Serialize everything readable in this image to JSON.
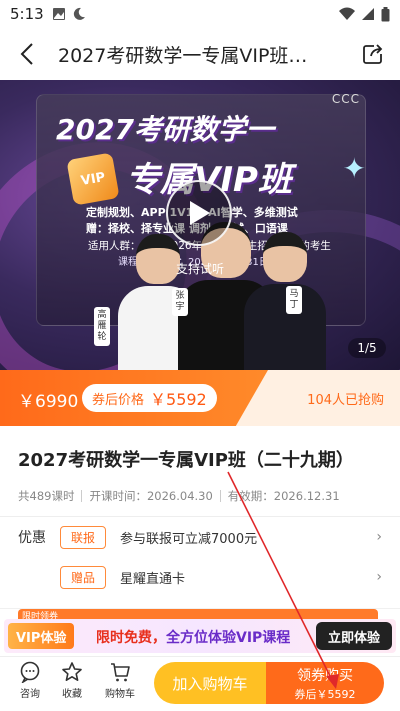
{
  "status_bar": {
    "time": "5:13",
    "left_icons": [
      "image-icon",
      "moon-icon"
    ],
    "right_icons": [
      "wifi-icon",
      "signal-icon",
      "battery-icon"
    ]
  },
  "nav": {
    "title": "2027考研数学一专属VIP班…",
    "back_icon": "back-chevron-icon",
    "share_icon": "share-icon"
  },
  "banner": {
    "brand_mark": "CCC",
    "headline_1": "2027考研数学一",
    "headline_2": "专属VIP班",
    "badge": "VIP",
    "features_1": "定制规划、APP 1V1    、AI智学、多维测试",
    "features_2": "赠：择校、择专业课    调剂、复试、口语课",
    "audience": "适用人群：参加 2026年12月研究生招生考试的考生",
    "validity": "课程有效期为：2026年12月31日",
    "trial": "支持试听",
    "teacher_names": [
      "高雁轮",
      "张宇",
      "马丁"
    ],
    "pager": "1/5"
  },
  "price": {
    "original": "￥6990",
    "coupon_label": "券后价格",
    "coupon_value": "￥5592",
    "bought": "104人已抢购"
  },
  "course": {
    "title": "2027考研数学一专属VIP班（二十九期）",
    "lessons": "共489课时",
    "open_time": "开课时间：2026.04.30",
    "valid_until": "有效期：2026.12.31"
  },
  "offers": {
    "label": "优惠",
    "items": [
      {
        "tag": "联报",
        "text": "参与联报可立减7000元"
      },
      {
        "tag": "赠品",
        "text": "星耀直通卡"
      }
    ]
  },
  "vip_promo": {
    "peek_text": "限时领券",
    "badge": "VIP体验",
    "text_red": "限时免费，",
    "text_purple": "全方位体验VIP课程",
    "cta": "立即体验"
  },
  "bottom_bar": {
    "consult": "咨询",
    "favorite": "收藏",
    "cart": "购物车",
    "add_cart": "加入购物车",
    "buy_line1": "领券购买",
    "buy_line2": "券后￥5592"
  },
  "colors": {
    "accent_orange": "#ff6a1a",
    "cart_yellow": "#ffc023",
    "vip_purple": "#6a2cc8",
    "annotation_red": "#e0282a"
  }
}
